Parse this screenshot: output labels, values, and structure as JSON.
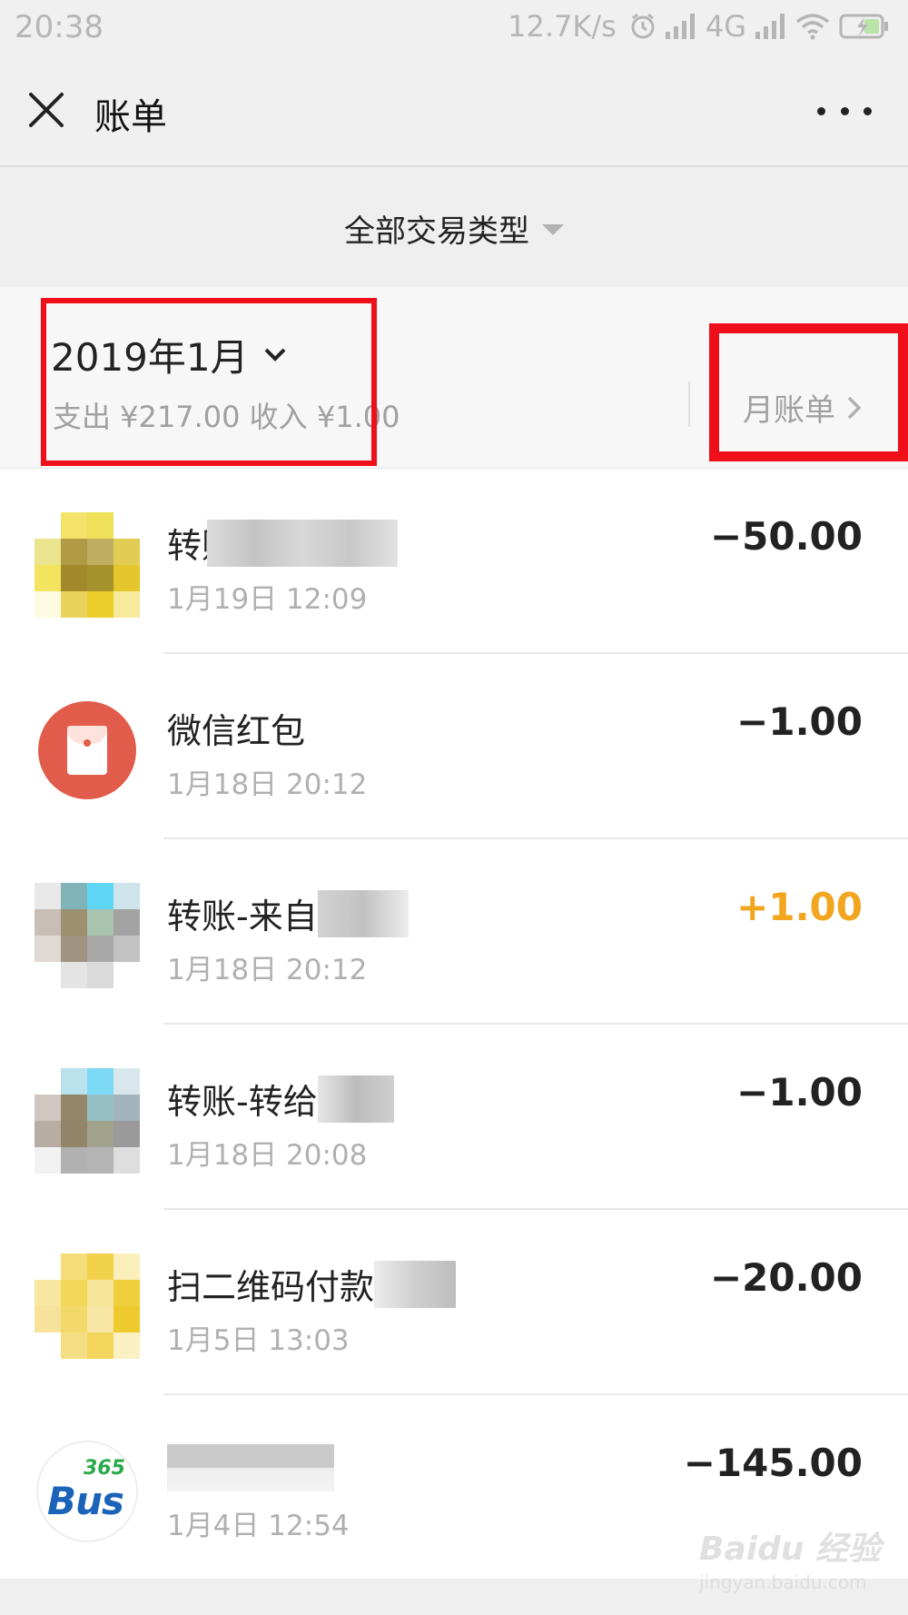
{
  "status_bar": {
    "time": "20:38",
    "speed": "12.7K/s",
    "network": "4G",
    "icons": [
      "alarm-icon",
      "signal-icon",
      "signal-icon",
      "wifi-icon",
      "battery-charging-icon"
    ]
  },
  "nav": {
    "title": "账单",
    "close_icon": "close-icon",
    "more_icon": "more-icon"
  },
  "filter": {
    "label": "全部交易类型"
  },
  "month": {
    "title": "2019年1月",
    "summary": "支出 ¥217.00 收入 ¥1.00",
    "monthly_bill_label": "月账单"
  },
  "transactions": [
    {
      "title": "转账",
      "time": "1月19日 12:09",
      "amount": "−50.00",
      "type": "expense",
      "avatar": "pixelated-yellow"
    },
    {
      "title": "微信红包",
      "time": "1月18日 20:12",
      "amount": "−1.00",
      "type": "expense",
      "avatar": "red-packet-icon"
    },
    {
      "title": "转账-来自",
      "time": "1月18日 20:12",
      "amount": "+1.00",
      "type": "income",
      "avatar": "pixelated-blue"
    },
    {
      "title": "转账-转给",
      "time": "1月18日 20:08",
      "amount": "−1.00",
      "type": "expense",
      "avatar": "pixelated-blue"
    },
    {
      "title": "扫二维码付款",
      "time": "1月5日 13:03",
      "amount": "−20.00",
      "type": "expense",
      "avatar": "pixelated-yellow"
    },
    {
      "title": "",
      "time": "1月4日 12:54",
      "amount": "−145.00",
      "type": "expense",
      "avatar": "bus365-logo"
    }
  ],
  "bus_logo": {
    "number": "365",
    "word": "Bus"
  },
  "watermark": {
    "top": "Baidu 经验",
    "bottom": "jingyan.baidu.com"
  },
  "colors": {
    "highlight": "#ee0f1a",
    "income": "#f2a51e",
    "red_packet": "#e15c4a",
    "background": "#f0f0f0"
  }
}
